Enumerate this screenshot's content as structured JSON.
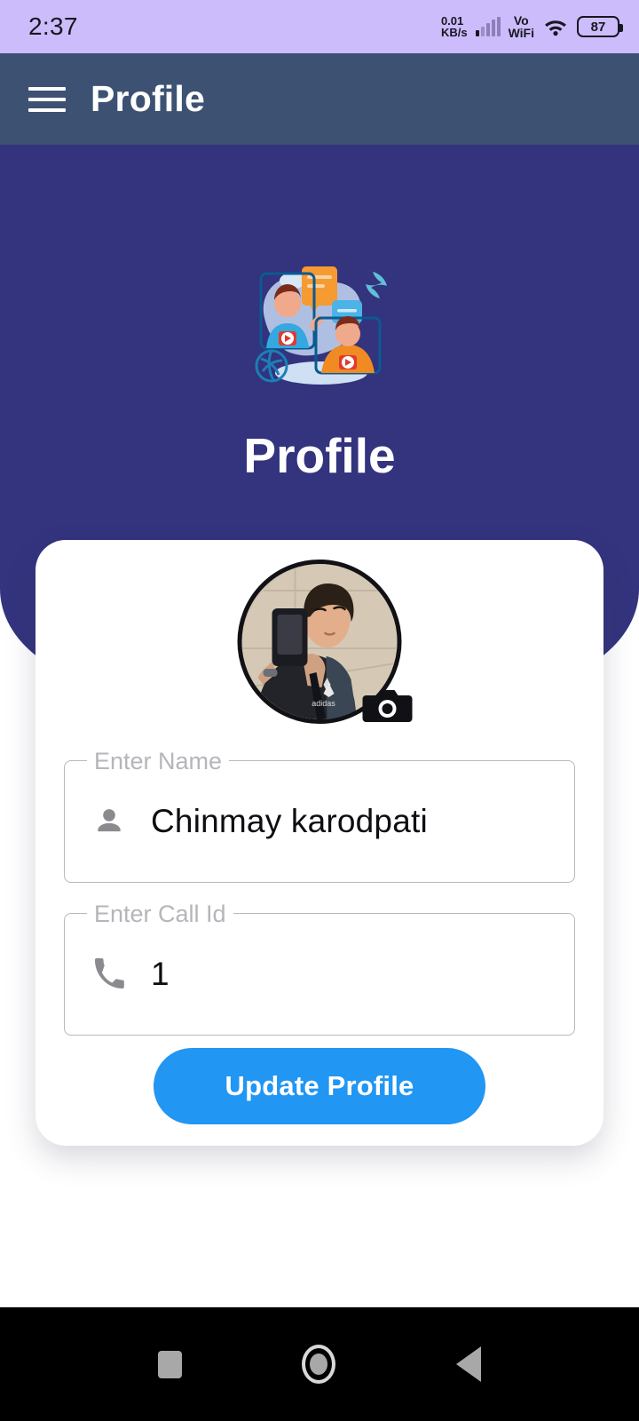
{
  "status_bar": {
    "time": "2:37",
    "network_rate": "0.01",
    "network_unit": "KB/s",
    "vo_label": "Vo",
    "wifi_label": "WiFi",
    "battery_level": "87",
    "bg_color": "#cdbcfc"
  },
  "app_bar": {
    "menu_icon": "hamburger-menu-icon",
    "title": "Profile",
    "bg_color": "#3d5273"
  },
  "hero": {
    "illustration": "video-call-illustration",
    "title": "Profile",
    "bg_color": "#33337e"
  },
  "card": {
    "avatar": {
      "alt": "user-profile-photo",
      "camera_badge_icon": "camera-icon"
    },
    "fields": [
      {
        "id": "name",
        "label": "Enter Name",
        "value": "Chinmay karodpati",
        "placeholder": "Enter Name",
        "icon": "person-icon"
      },
      {
        "id": "call_id",
        "label": "Enter Call Id",
        "value": "1",
        "placeholder": "Enter Call Id",
        "icon": "phone-icon"
      }
    ],
    "submit_button": {
      "label": "Update Profile",
      "color": "#2196f3"
    }
  },
  "nav_bar": {
    "recents_label": "recents-icon",
    "home_label": "home-icon",
    "back_label": "back-icon",
    "bg_color": "#000000"
  }
}
